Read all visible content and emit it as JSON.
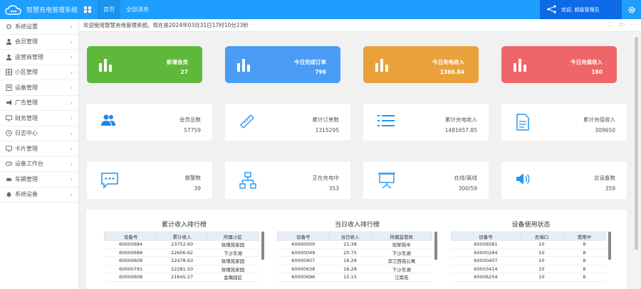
{
  "header": {
    "brand": "智慧充电管理系统",
    "tabs": [
      {
        "label": "首页"
      },
      {
        "label": "全部消息"
      }
    ],
    "user": "欢迎, 超级管理员"
  },
  "sidebar": {
    "items": [
      {
        "label": "系统设置",
        "icon": "gear-icon"
      },
      {
        "label": "会员管理",
        "icon": "user-icon"
      },
      {
        "label": "运营商管理",
        "icon": "user-icon"
      },
      {
        "label": "小区管理",
        "icon": "grid-icon"
      },
      {
        "label": "设备管理",
        "icon": "doc-icon"
      },
      {
        "label": "广告管理",
        "icon": "megaphone-icon"
      },
      {
        "label": "财务管理",
        "icon": "monitor-icon"
      },
      {
        "label": "日志中心",
        "icon": "clock-icon"
      },
      {
        "label": "卡片管理",
        "icon": "monitor-icon"
      },
      {
        "label": "设备工作台",
        "icon": "gamepad-icon"
      },
      {
        "label": "车辆管理",
        "icon": "car-icon"
      },
      {
        "label": "系统设备",
        "icon": "bell-icon"
      }
    ]
  },
  "breadcrumb": "欢迎使用智慧充电管理系统。现在是2024年03月31日17时10分23秒",
  "stats_colored": [
    {
      "title": "新增会员",
      "value": "27",
      "color": "#5fb83b"
    },
    {
      "title": "今日完成订单",
      "value": "796",
      "color": "#4a9cf5"
    },
    {
      "title": "今日充电收入",
      "value": "1366.84",
      "color": "#e9a23b"
    },
    {
      "title": "今日充值收入",
      "value": "180",
      "color": "#ef6668"
    }
  ],
  "stats_white_1": [
    {
      "title": "会员总数",
      "value": "57759",
      "icon": "users-icon"
    },
    {
      "title": "累计订单数",
      "value": "1315295",
      "icon": "ruler-icon"
    },
    {
      "title": "累计充电收入",
      "value": "1481657.85",
      "icon": "list-icon"
    },
    {
      "title": "累计充值收入",
      "value": "309650",
      "icon": "file-icon"
    }
  ],
  "stats_white_2": [
    {
      "title": "报警数",
      "value": "39",
      "icon": "message-icon"
    },
    {
      "title": "正在充电中",
      "value": "353",
      "icon": "network-icon"
    },
    {
      "title": "在线/离线",
      "value": "300/59",
      "icon": "easel-icon"
    },
    {
      "title": "总设备数",
      "value": "359",
      "icon": "speaker-icon"
    }
  ],
  "tables": [
    {
      "title": "累计收入排行榜",
      "columns": [
        "设备号",
        "累计收入",
        "所属小区"
      ],
      "rows": [
        [
          "60000684",
          "23752.60",
          "玫瑰苑家园"
        ],
        [
          "60000688",
          "22606.62",
          "下沙东湖"
        ],
        [
          "60000608",
          "22478.63",
          "玫瑰苑家园"
        ],
        [
          "60000791",
          "22281.50",
          "玫瑰苑家园"
        ],
        [
          "60000608",
          "21645.27",
          "金隅园区"
        ]
      ]
    },
    {
      "title": "当日收入排行榜",
      "columns": [
        "设备号",
        "当日收入",
        "所属监管局"
      ],
      "rows": [
        [
          "60000000",
          "21.38",
          "琅琊苑中"
        ],
        [
          "60000049",
          "20.75",
          "下沙东湖"
        ],
        [
          "60000407",
          "16.28",
          "滨江西苑公寓"
        ],
        [
          "60000638",
          "16.28",
          "下沙东湖"
        ],
        [
          "60000696",
          "15.15",
          "江南苑"
        ]
      ]
    },
    {
      "title": "设备使用状态",
      "columns": [
        "设备号",
        "总端口",
        "使用中"
      ],
      "rows": [
        [
          "60006581",
          "10",
          "8"
        ],
        [
          "60000284",
          "10",
          "8"
        ],
        [
          "60000407",
          "10",
          "8"
        ],
        [
          "60003414",
          "10",
          "8"
        ],
        [
          "60006254",
          "10",
          "8"
        ]
      ]
    }
  ]
}
